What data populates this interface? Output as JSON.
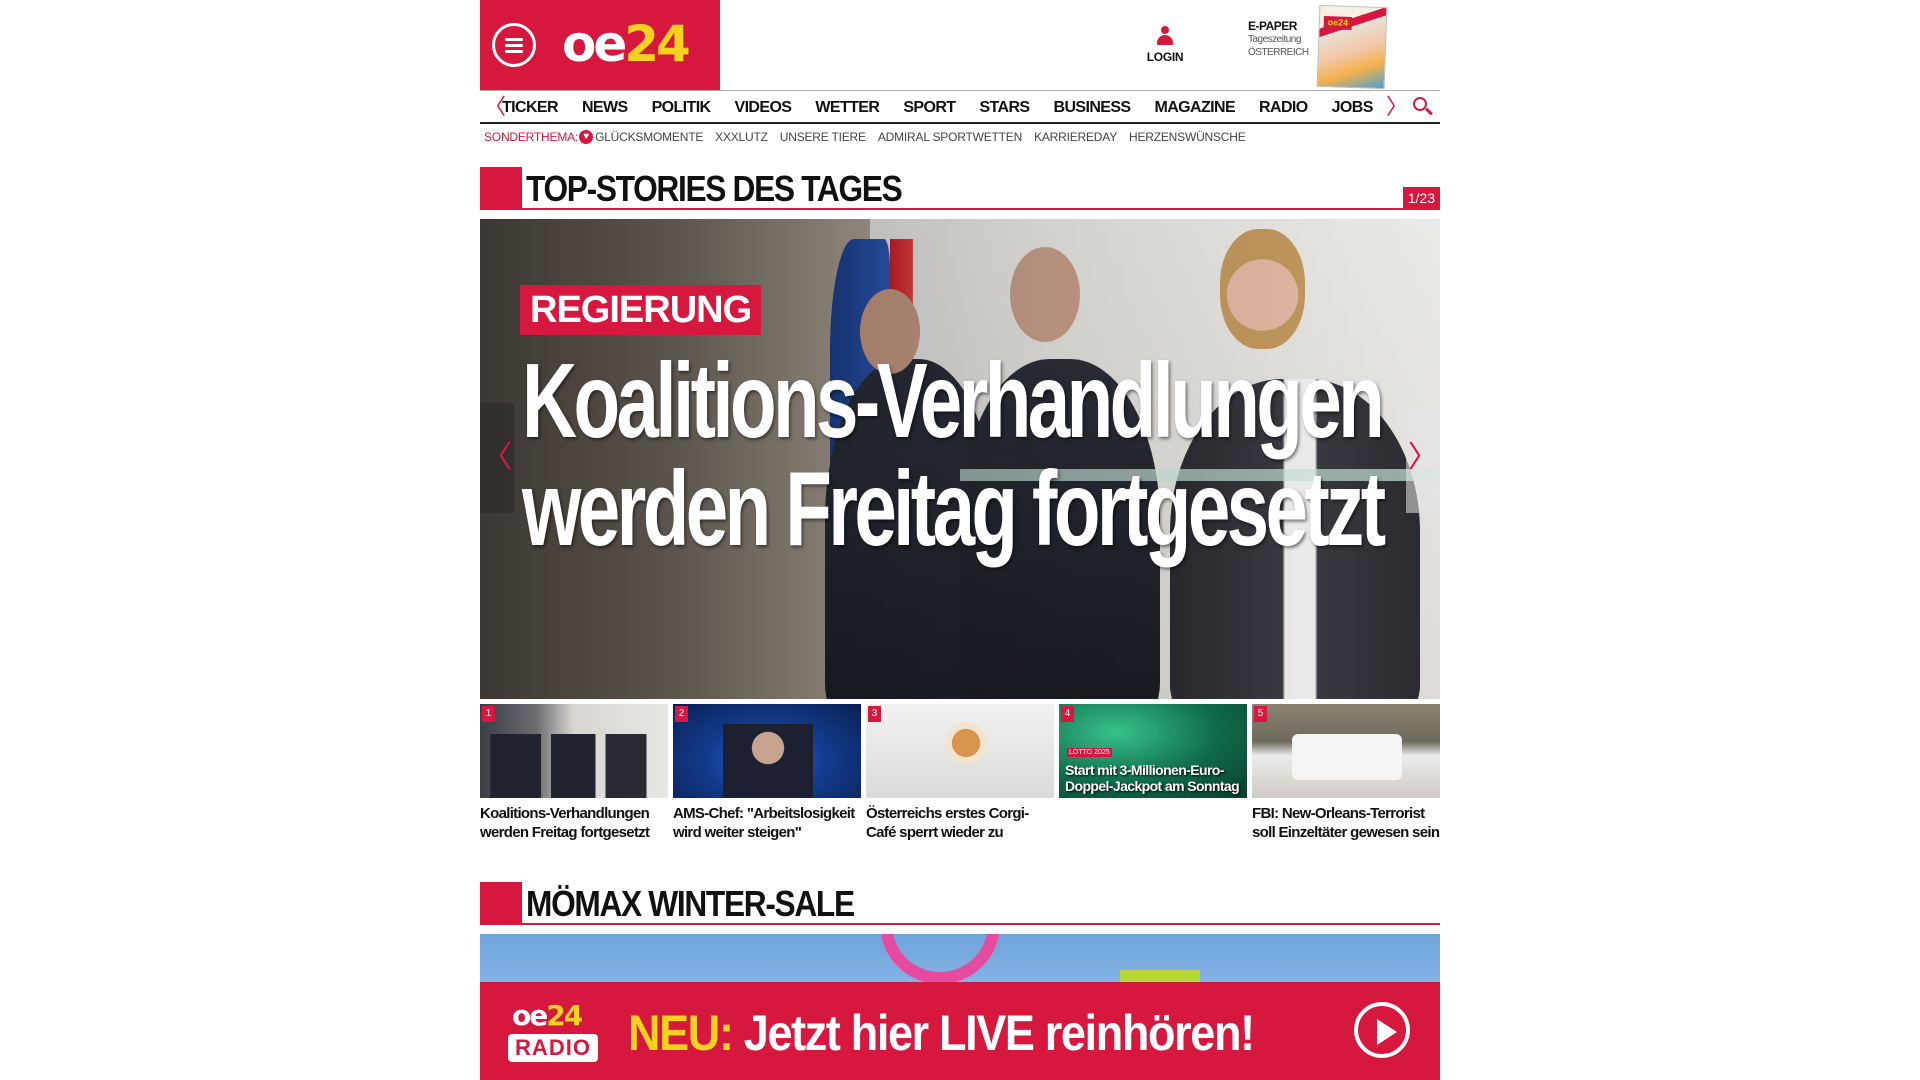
{
  "header": {
    "logo": {
      "part1": "oe",
      "part2": "24"
    },
    "login_label": "LOGIN",
    "epaper": {
      "title": "E-PAPER",
      "sub1": "Tageszeitung",
      "sub2": "ÖSTERREICH",
      "cover_mini": "oe24"
    }
  },
  "nav": {
    "prev_arrow": "〈",
    "next_arrow": "〉",
    "items": [
      "TICKER",
      "NEWS",
      "POLITIK",
      "VIDEOS",
      "WETTER",
      "SPORT",
      "STARS",
      "BUSINESS",
      "MAGAZINE",
      "RADIO",
      "JOBS"
    ]
  },
  "sonderthema": {
    "label": "SONDERTHEMA:",
    "items": [
      "GLÜCKSMOMENTE",
      "XXXLUTZ",
      "UNSERE TIERE",
      "ADMIRAL SPORTWETTEN",
      "KARRIEREDAY",
      "HERZENSWÜNSCHE"
    ]
  },
  "top_stories": {
    "title": "TOP-STORIES DES TAGES",
    "counter": "1/23",
    "hero": {
      "category": "REGIERUNG",
      "headline": "Koalitions-Verhandlungen werden Freitag fortgesetzt",
      "prev": "〈",
      "next": "〉"
    },
    "thumbs": [
      {
        "num": "1",
        "caption": "Koalitions-Verhandlungen werden Freitag fortgesetzt"
      },
      {
        "num": "2",
        "caption": "AMS-Chef: \"Arbeitslosigkeit wird weiter steigen\""
      },
      {
        "num": "3",
        "caption": "Österreichs erstes Corgi-Café sperrt wieder zu"
      },
      {
        "num": "4",
        "caption": "",
        "overlay": "Start mit 3-Millionen-Euro-Doppel-Jackpot am Sonntag",
        "tag": "LOTTO 2025"
      },
      {
        "num": "5",
        "caption": "FBI: New-Orleans-Terrorist soll Einzeltäter gewesen sein"
      }
    ]
  },
  "promo_section": {
    "title": "MÖMAX WINTER-SALE"
  },
  "radio_bar": {
    "logo_part1": "oe",
    "logo_part2": "24",
    "logo_radio": "RADIO",
    "neu": "NEU:",
    "text": "Jetzt hier LIVE reinhören!"
  },
  "colors": {
    "brand_red": "#d6173e",
    "brand_yellow": "#f4d21f"
  }
}
